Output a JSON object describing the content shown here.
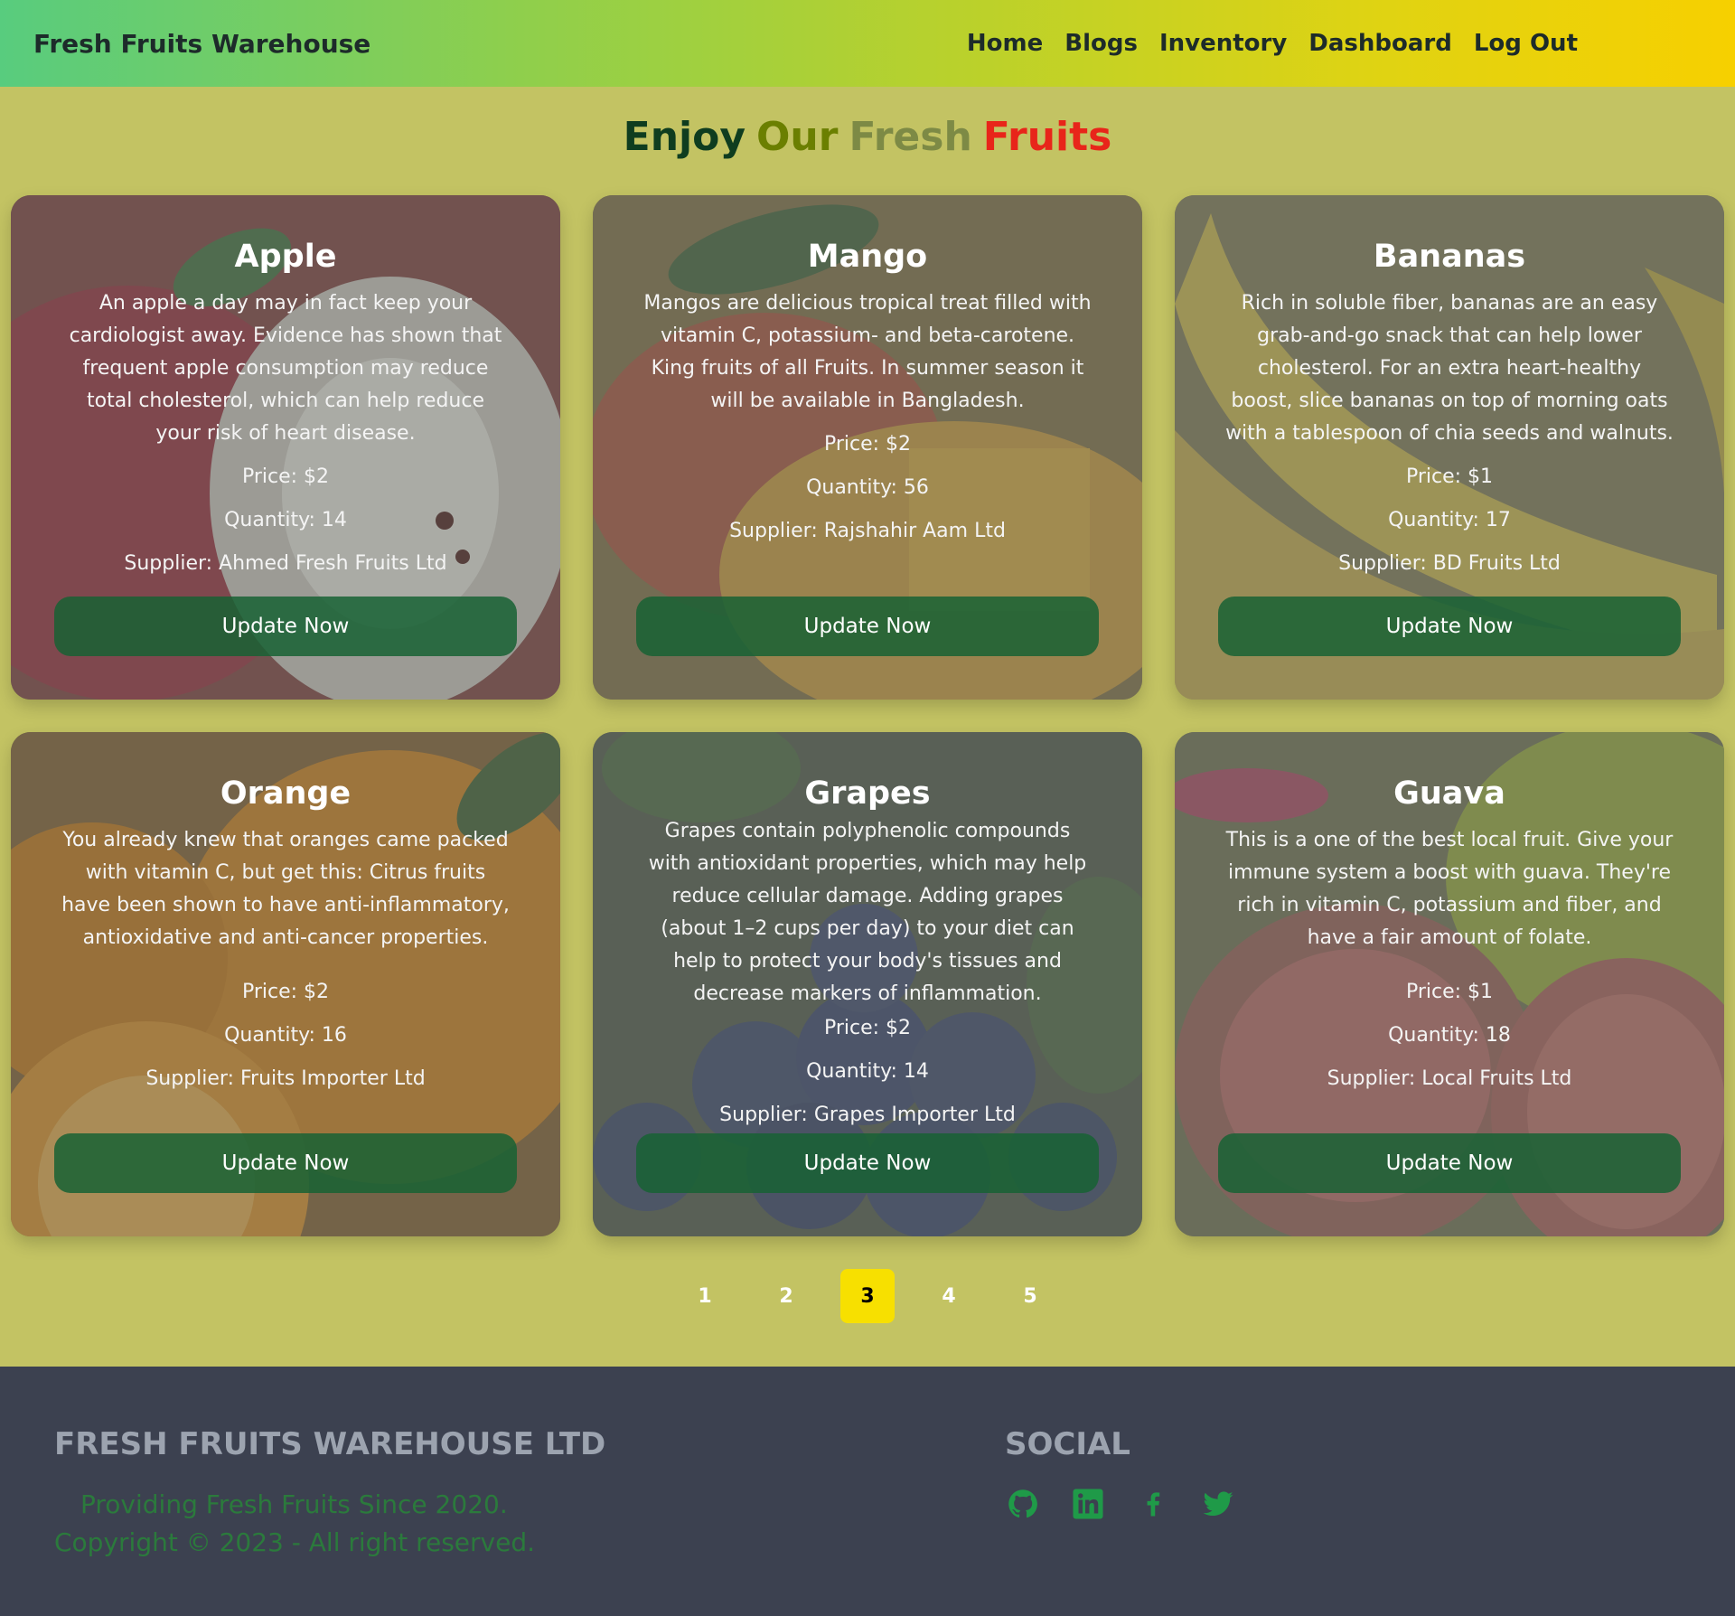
{
  "nav": {
    "brand": "Fresh Fruits Warehouse",
    "links": [
      "Home",
      "Blogs",
      "Inventory",
      "Dashboard",
      "Log Out"
    ]
  },
  "hero": {
    "words": [
      "Enjoy",
      "Our",
      "Fresh",
      "Fruits"
    ],
    "colors": [
      "#0f3d1f",
      "#6b7f00",
      "#7d8a45",
      "#e8251a"
    ]
  },
  "products": [
    {
      "name": "Apple",
      "description": "An apple a day may in fact keep your cardiologist away. Evidence has shown that frequent apple consumption may reduce total cholesterol, which can help reduce your risk of heart disease.",
      "price": "Price: $2",
      "quantity": "Quantity: 14",
      "supplier": "Supplier: Ahmed Fresh Fruits Ltd",
      "button": "Update Now"
    },
    {
      "name": "Mango",
      "description": "Mangos are delicious tropical treat filled with vitamin C, potassium- and beta-carotene. King fruits of all Fruits. In summer season it will be available in Bangladesh.",
      "price": "Price: $2",
      "quantity": "Quantity: 56",
      "supplier": "Supplier: Rajshahir Aam Ltd",
      "button": "Update Now"
    },
    {
      "name": "Bananas",
      "description": "Rich in soluble fiber, bananas are an easy grab-and-go snack that can help lower cholesterol. For an extra heart-healthy boost, slice bananas on top of morning oats with a tablespoon of chia seeds and walnuts.",
      "price": "Price: $1",
      "quantity": "Quantity: 17",
      "supplier": "Supplier: BD Fruits Ltd",
      "button": "Update Now"
    },
    {
      "name": "Orange",
      "description": "You already knew that oranges came packed with vitamin C, but get this: Citrus fruits have been shown to have anti-inflammatory, antioxidative and anti-cancer properties.",
      "price": "Price: $2",
      "quantity": "Quantity: 16",
      "supplier": "Supplier: Fruits Importer Ltd",
      "button": "Update Now"
    },
    {
      "name": "Grapes",
      "description": "Grapes contain polyphenolic compounds with antioxidant properties, which may help reduce cellular damage. Adding grapes (about 1–2 cups per day) to your diet can help to protect your body's tissues and decrease markers of inflammation.",
      "price": "Price: $2",
      "quantity": "Quantity: 14",
      "supplier": "Supplier: Grapes Importer Ltd",
      "button": "Update Now"
    },
    {
      "name": "Guava",
      "description": "This is a one of the best local fruit. Give your immune system a boost with guava. They're rich in vitamin C, potassium and fiber, and have a fair amount of folate.",
      "price": "Price: $1",
      "quantity": "Quantity: 18",
      "supplier": "Supplier: Local Fruits Ltd",
      "button": "Update Now"
    }
  ],
  "pagination": {
    "pages": [
      "1",
      "2",
      "3",
      "4",
      "5"
    ],
    "active": "3",
    "active_color": "#f7e000"
  },
  "footer": {
    "company": "FRESH FRUITS WAREHOUSE LTD",
    "tagline": "Providing Fresh Fruits Since 2020.",
    "copyright": "Copyright © 2023 - All right reserved.",
    "social_heading": "SOCIAL",
    "social_icons": [
      "github-icon",
      "linkedin-icon",
      "facebook-icon",
      "twitter-icon"
    ],
    "icon_color": "#1f9a48"
  }
}
